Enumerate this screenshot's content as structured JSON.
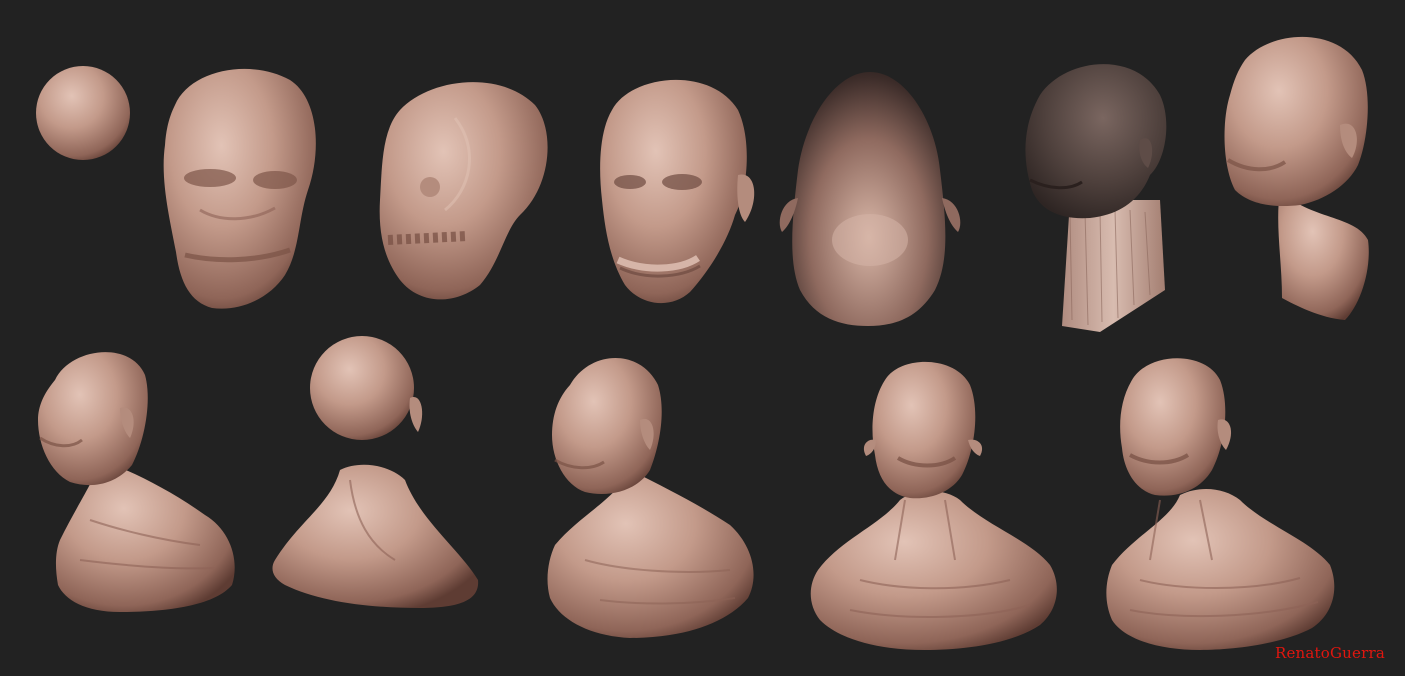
{
  "signature": "RenatoGuerra",
  "colors": {
    "background": "#222222",
    "clay": "#c39a8a",
    "clay_dark": "#4b3b37",
    "signature": "#e0160f"
  },
  "sculpt_stages": [
    {
      "name": "sphere"
    },
    {
      "name": "skull-block-front"
    },
    {
      "name": "skull-teeth-side"
    },
    {
      "name": "face-block"
    },
    {
      "name": "head-top-view"
    },
    {
      "name": "head-dark-material"
    },
    {
      "name": "head-neck"
    },
    {
      "name": "bust-left"
    },
    {
      "name": "bust-back"
    },
    {
      "name": "bust-three-quarter"
    },
    {
      "name": "bust-detailed-front"
    },
    {
      "name": "bust-detailed-final"
    }
  ]
}
